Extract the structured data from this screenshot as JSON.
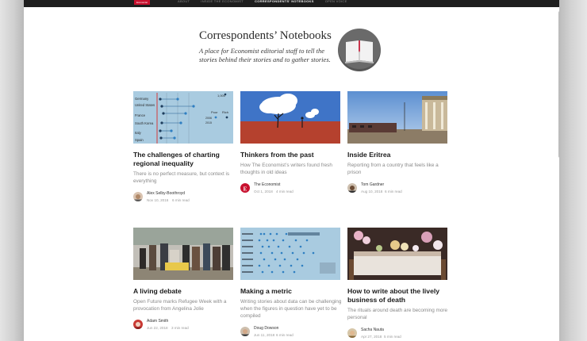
{
  "nav": {
    "logo": "Economist",
    "items": [
      "ABOUT",
      "INSIDE THE ECONOMIST",
      "CORRESPONDENTS' NOTEBOOKS",
      "OPEN VOICE"
    ],
    "active_index": 2
  },
  "hero": {
    "title": "Correspondents’ Notebooks",
    "description": "A place for Economist editorial staff to tell the stories behind their stories and to gather stories.",
    "icon": "open-book-icon"
  },
  "cards": [
    {
      "title": "The challenges of charting regional inequality",
      "subtitle": "There is no perfect measure, but context is everything",
      "author": "Alex Selby-Boothroyd",
      "date": "Nov 10, 2016",
      "read_time": "6 min read",
      "thumbnail": "dot-chart",
      "chart_labels": [
        "Germany",
        "United States",
        "France",
        "South Korea",
        "Italy",
        "Spain"
      ],
      "chart_legend": [
        "Poor",
        "Rich",
        "2006",
        "2015"
      ],
      "chart_value": "1,000"
    },
    {
      "title": "Thinkers from the past",
      "subtitle": "How The Economist’s writers found fresh thoughts in old ideas",
      "author": "The Economist",
      "date": "Oct 1, 2018",
      "read_time": "4 min read",
      "thumbnail": "cloud-trees-illustration"
    },
    {
      "title": "Inside Eritrea",
      "subtitle": "Reporting from a country that feels like a prison",
      "author": "Tom Gardner",
      "date": "Aug 10, 2018",
      "read_time": "6 min read",
      "thumbnail": "train-station-photo"
    },
    {
      "title": "A living debate",
      "subtitle": "Open Future marks Refugee Week with a provocation from Angelina Jolie",
      "author": "Adam Smith",
      "date": "Jun 22, 2018",
      "read_time": "3 min read",
      "thumbnail": "refugees-photo"
    },
    {
      "title": "Making a metric",
      "subtitle": "Writing stories about data can be challenging when the figures in question have yet to be compiled",
      "author": "Doug Dowson",
      "date": "Jun 11, 2018",
      "read_time": "6 min read",
      "thumbnail": "metric-chart"
    },
    {
      "title": "How to write about the lively business of death",
      "subtitle": "The rituals around death are becoming more personal",
      "author": "Sacha Nauta",
      "date": "Apr 27, 2018",
      "read_time": "5 min read",
      "thumbnail": "funeral-photo"
    }
  ],
  "colors": {
    "topbar": "#1e1e1e",
    "brand_red": "#c8102e",
    "chart_blue_bg": "#a9cbe0",
    "sky_blue": "#3f74c7",
    "ground_red": "#b5412e"
  }
}
